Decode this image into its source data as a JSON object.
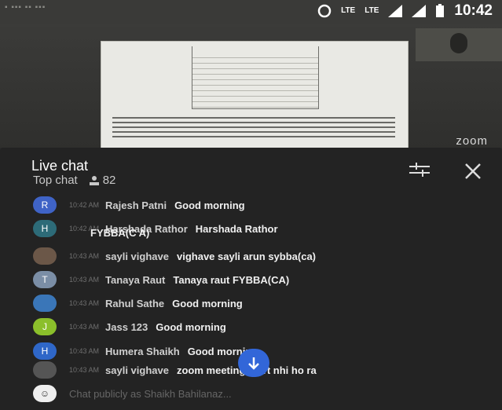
{
  "status": {
    "lte1": "LTE",
    "lte2": "LTE",
    "time": "10:42"
  },
  "video": {
    "watermark": "zoom"
  },
  "chat": {
    "title": "Live chat",
    "mode": "Top chat",
    "viewers": "82",
    "messages": [
      {
        "initial": "R",
        "color": "#3f63c6",
        "time": "10:42 AM",
        "author": "Rajesh Patni",
        "text": "Good morning"
      },
      {
        "initial": "H",
        "color": "#2d6b78",
        "time": "10:42 AM",
        "author": "Harshada Rathor",
        "text": "Harshada Rathor",
        "continuation": "FYBBA(C A)"
      },
      {
        "initial": "",
        "color": "#6b5748",
        "time": "10:43 AM",
        "author": "sayli vighave",
        "text": "vighave sayli arun sybba(ca)"
      },
      {
        "initial": "T",
        "color": "#7b8ea6",
        "time": "10:43 AM",
        "author": "Tanaya Raut",
        "text": "Tanaya raut FYBBA(CA)"
      },
      {
        "initial": "",
        "color": "#3a76b8",
        "time": "10:43 AM",
        "author": "Rahul Sathe",
        "text": "Good morning"
      },
      {
        "initial": "J",
        "color": "#8bbf2b",
        "time": "10:43 AM",
        "author": "Jass 123",
        "text": "Good morning"
      },
      {
        "initial": "H",
        "color": "#2f67c8",
        "time": "10:43 AM",
        "author": "Humera Shaikh",
        "text": "Good morning"
      },
      {
        "initial": "",
        "color": "#555555",
        "time": "10:43 AM",
        "author": "sayli vighave",
        "text": "zoom meeting start nhi ho ra"
      }
    ],
    "input_placeholder": "Chat publicly as Shaikh Bahilanaz..."
  }
}
